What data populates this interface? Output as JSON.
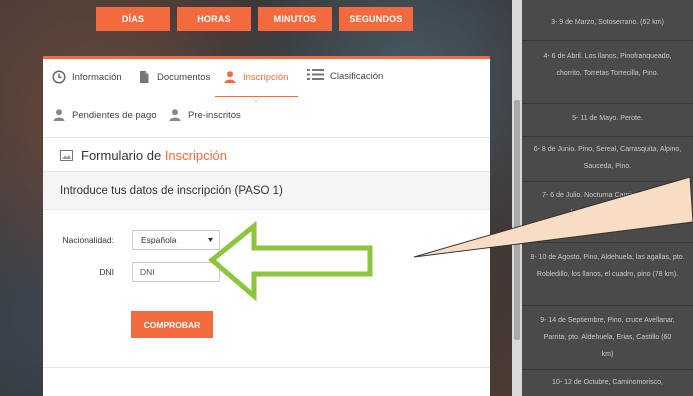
{
  "countdown": {
    "items": [
      "DÍAS",
      "HORAS",
      "MINUTOS",
      "SEGUNDOS"
    ]
  },
  "tabs": [
    {
      "label": "Información",
      "icon": "clock-icon"
    },
    {
      "label": "Documentos",
      "icon": "document-icon"
    },
    {
      "label": "Inscripción",
      "icon": "user-icon",
      "active": true
    },
    {
      "label": "Clasificación",
      "icon": "list-icon"
    },
    {
      "label": "Pendientes de pago",
      "icon": "user-icon"
    },
    {
      "label": "Pre-inscritos",
      "icon": "user-icon"
    }
  ],
  "form": {
    "title_prefix": "Formulario de ",
    "title_accent": "Inscripción",
    "step_heading": "Introduce tus datos de inscripción (PASO 1)",
    "nationality_label": "Nacionalidad:",
    "nationality_value": "Española",
    "dni_label": "DNI",
    "dni_placeholder": "DNI",
    "submit_label": "COMPROBAR"
  },
  "sidebar": {
    "items": [
      "3- 9 de Marzo, Sotoserrano. (62 km)",
      "4- 6 de Abril. Los llanos, Pinofranqueado, chorrito, Torretas Torrecilla, Pino.",
      "5- 11 de Mayo. Perote.",
      "6- 8 de Junio. Pino, Sereal, Carrasquita, Alpino, Sauceda, Pino.",
      "7- 6 de Julio. Nocturna Caminomorisco, ... Ladrillar, Alavea (35km)",
      "8- 10 de Agosto, Pino, Aldehuela, las agallas, pto. Robledillo, los llanos, el cuadro, pino (78 km).",
      "9- 14 de Septiembre, Pino, cruce Avellanar, Parrita, pto. Aldehuela, Erias, Castillo (60 km)",
      "10- 12 de Octubre, Caminomorisco,"
    ]
  },
  "colors": {
    "accent": "#f26a3d",
    "arrow": "#8cc63f",
    "callout": "#f9dcc4"
  }
}
